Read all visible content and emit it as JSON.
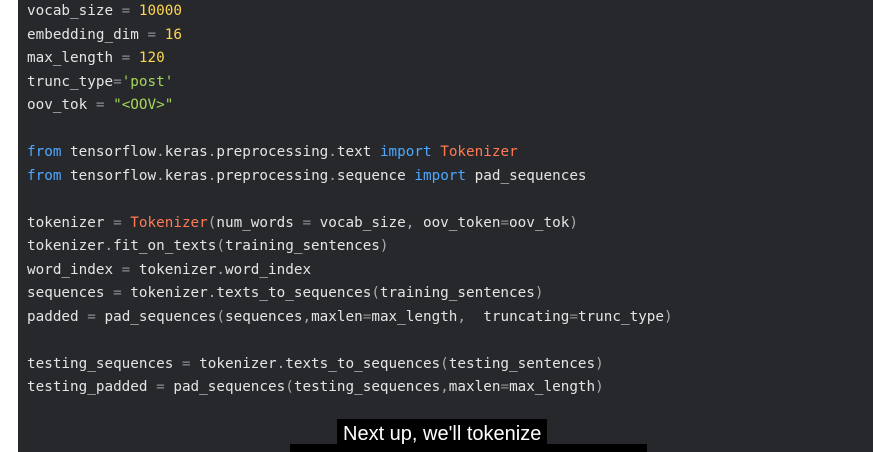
{
  "code_lines": [
    [
      {
        "t": "vocab_size",
        "c": "id"
      },
      {
        "t": " = ",
        "c": "op"
      },
      {
        "t": "10000",
        "c": "num"
      }
    ],
    [
      {
        "t": "embedding_dim",
        "c": "id"
      },
      {
        "t": " = ",
        "c": "op"
      },
      {
        "t": "16",
        "c": "num"
      }
    ],
    [
      {
        "t": "max_length",
        "c": "id"
      },
      {
        "t": " = ",
        "c": "op"
      },
      {
        "t": "120",
        "c": "num"
      }
    ],
    [
      {
        "t": "trunc_type",
        "c": "id"
      },
      {
        "t": "=",
        "c": "op"
      },
      {
        "t": "'post'",
        "c": "str"
      }
    ],
    [
      {
        "t": "oov_tok",
        "c": "id"
      },
      {
        "t": " = ",
        "c": "op"
      },
      {
        "t": "\"<OOV>\"",
        "c": "str"
      }
    ],
    [],
    [
      {
        "t": "from",
        "c": "kw"
      },
      {
        "t": " tensorflow",
        "c": "id"
      },
      {
        "t": ".",
        "c": "dim"
      },
      {
        "t": "keras",
        "c": "id"
      },
      {
        "t": ".",
        "c": "dim"
      },
      {
        "t": "preprocessing",
        "c": "id"
      },
      {
        "t": ".",
        "c": "dim"
      },
      {
        "t": "text ",
        "c": "id"
      },
      {
        "t": "import",
        "c": "kw"
      },
      {
        "t": " Tokenizer",
        "c": "cls"
      }
    ],
    [
      {
        "t": "from",
        "c": "kw"
      },
      {
        "t": " tensorflow",
        "c": "id"
      },
      {
        "t": ".",
        "c": "dim"
      },
      {
        "t": "keras",
        "c": "id"
      },
      {
        "t": ".",
        "c": "dim"
      },
      {
        "t": "preprocessing",
        "c": "id"
      },
      {
        "t": ".",
        "c": "dim"
      },
      {
        "t": "sequence ",
        "c": "id"
      },
      {
        "t": "import",
        "c": "kw"
      },
      {
        "t": " pad_sequences",
        "c": "id"
      }
    ],
    [],
    [
      {
        "t": "tokenizer",
        "c": "id"
      },
      {
        "t": " = ",
        "c": "op"
      },
      {
        "t": "Tokenizer",
        "c": "cls"
      },
      {
        "t": "(",
        "c": "dim"
      },
      {
        "t": "num_words",
        "c": "id"
      },
      {
        "t": " = ",
        "c": "op"
      },
      {
        "t": "vocab_size",
        "c": "id"
      },
      {
        "t": ", ",
        "c": "dim"
      },
      {
        "t": "oov_token",
        "c": "id"
      },
      {
        "t": "=",
        "c": "op"
      },
      {
        "t": "oov_tok",
        "c": "id"
      },
      {
        "t": ")",
        "c": "dim"
      }
    ],
    [
      {
        "t": "tokenizer",
        "c": "id"
      },
      {
        "t": ".",
        "c": "dim"
      },
      {
        "t": "fit_on_texts",
        "c": "id"
      },
      {
        "t": "(",
        "c": "dim"
      },
      {
        "t": "training_sentences",
        "c": "id"
      },
      {
        "t": ")",
        "c": "dim"
      }
    ],
    [
      {
        "t": "word_index",
        "c": "id"
      },
      {
        "t": " = ",
        "c": "op"
      },
      {
        "t": "tokenizer",
        "c": "id"
      },
      {
        "t": ".",
        "c": "dim"
      },
      {
        "t": "word_index",
        "c": "id"
      }
    ],
    [
      {
        "t": "sequences",
        "c": "id"
      },
      {
        "t": " = ",
        "c": "op"
      },
      {
        "t": "tokenizer",
        "c": "id"
      },
      {
        "t": ".",
        "c": "dim"
      },
      {
        "t": "texts_to_sequences",
        "c": "id"
      },
      {
        "t": "(",
        "c": "dim"
      },
      {
        "t": "training_sentences",
        "c": "id"
      },
      {
        "t": ")",
        "c": "dim"
      }
    ],
    [
      {
        "t": "padded",
        "c": "id"
      },
      {
        "t": " = ",
        "c": "op"
      },
      {
        "t": "pad_sequences",
        "c": "id"
      },
      {
        "t": "(",
        "c": "dim"
      },
      {
        "t": "sequences",
        "c": "id"
      },
      {
        "t": ",",
        "c": "dim"
      },
      {
        "t": "maxlen",
        "c": "id"
      },
      {
        "t": "=",
        "c": "op"
      },
      {
        "t": "max_length",
        "c": "id"
      },
      {
        "t": ",  ",
        "c": "dim"
      },
      {
        "t": "truncating",
        "c": "id"
      },
      {
        "t": "=",
        "c": "op"
      },
      {
        "t": "trunc_type",
        "c": "id"
      },
      {
        "t": ")",
        "c": "dim"
      }
    ],
    [],
    [
      {
        "t": "testing_sequences",
        "c": "id"
      },
      {
        "t": " = ",
        "c": "op"
      },
      {
        "t": "tokenizer",
        "c": "id"
      },
      {
        "t": ".",
        "c": "dim"
      },
      {
        "t": "texts_to_sequences",
        "c": "id"
      },
      {
        "t": "(",
        "c": "dim"
      },
      {
        "t": "testing_sentences",
        "c": "id"
      },
      {
        "t": ")",
        "c": "dim"
      }
    ],
    [
      {
        "t": "testing_padded",
        "c": "id"
      },
      {
        "t": " = ",
        "c": "op"
      },
      {
        "t": "pad_sequences",
        "c": "id"
      },
      {
        "t": "(",
        "c": "dim"
      },
      {
        "t": "testing_sequences",
        "c": "id"
      },
      {
        "t": ",",
        "c": "dim"
      },
      {
        "t": "maxlen",
        "c": "id"
      },
      {
        "t": "=",
        "c": "op"
      },
      {
        "t": "max_length",
        "c": "id"
      },
      {
        "t": ")",
        "c": "dim"
      }
    ]
  ],
  "caption": "Next up, we'll tokenize",
  "colors": {
    "background": "#26282b",
    "identifier": "#e4e4e4",
    "keyword": "#4fa8ff",
    "number": "#ffd54f",
    "string": "#a5d65a",
    "class": "#ff7a55"
  }
}
